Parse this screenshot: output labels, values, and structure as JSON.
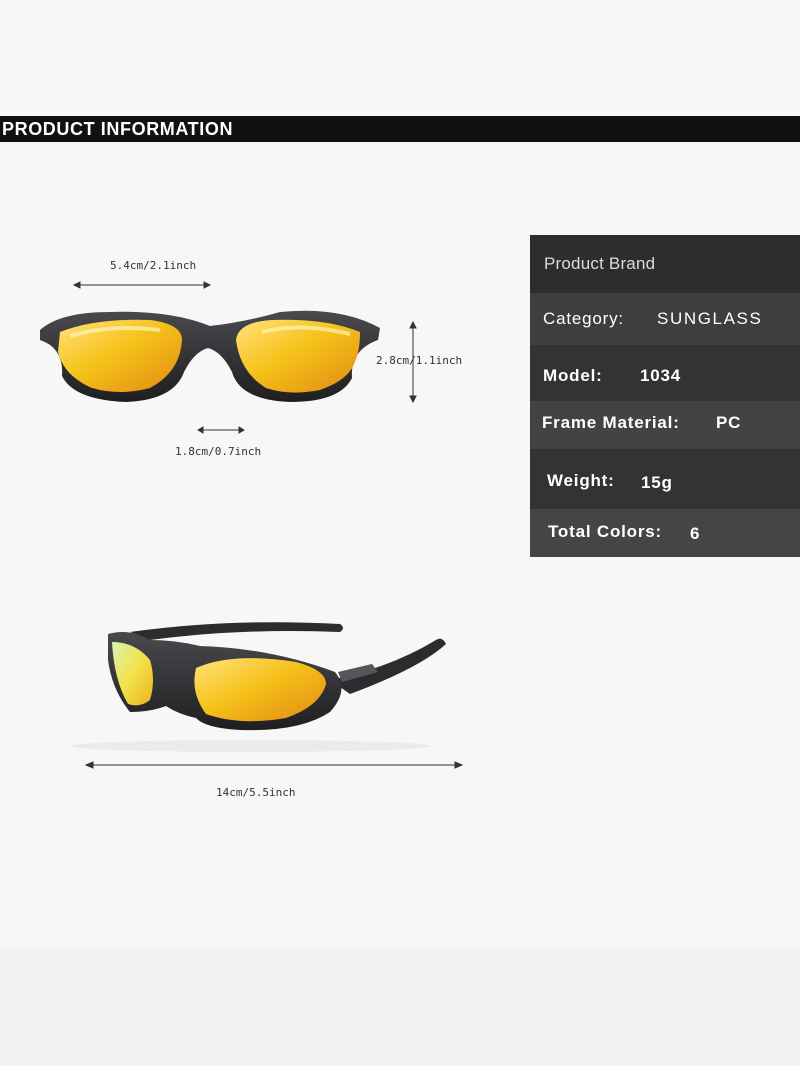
{
  "header": {
    "title": "PRODUCT INFORMATION"
  },
  "dimensions": {
    "lens_width": "5.4cm/2.1inch",
    "lens_height": "2.8cm/1.1inch",
    "bridge_width": "1.8cm/0.7inch",
    "temple_length": "14cm/5.5inch"
  },
  "specs": {
    "brand_label": "Product Brand",
    "category_label": "Category:",
    "category_value": "SUNGLASS",
    "model_label": "Model:",
    "model_value": "1034",
    "frame_label": "Frame Material:",
    "frame_value": "PC",
    "weight_label": "Weight:",
    "weight_value": "15g",
    "colors_label": "Total Colors:",
    "colors_value": "6"
  },
  "colors": {
    "band": "#111111",
    "panel": "#343434",
    "frame": "#2c2c2e",
    "lens": "#f5c21b"
  }
}
